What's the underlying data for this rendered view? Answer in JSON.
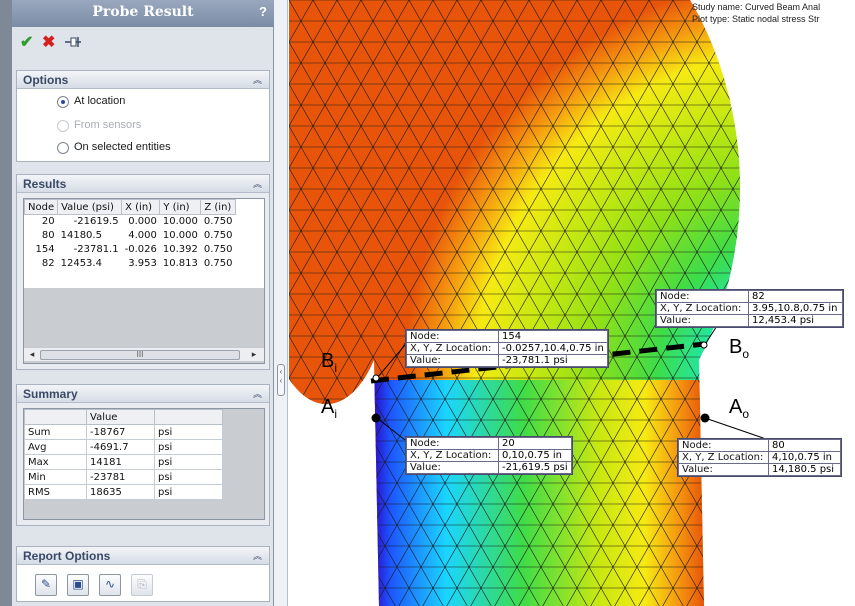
{
  "panel": {
    "title": "Probe Result",
    "help": "?",
    "icons": {
      "ok": "check-icon",
      "cancel": "close-icon",
      "pin": "pushpin-icon"
    }
  },
  "options": {
    "title": "Options",
    "at_location": "At location",
    "from_sensors": "From sensors",
    "on_selected": "On selected entities"
  },
  "results": {
    "title": "Results",
    "columns": [
      "Node",
      "Value (psi)",
      "X (in)",
      "Y (in)",
      "Z (in)"
    ],
    "rows": [
      {
        "node": "20",
        "value": "-21619.5",
        "x": "0.000",
        "y": "10.000",
        "z": "0.750"
      },
      {
        "node": "80",
        "value": "14180.5",
        "x": "4.000",
        "y": "10.000",
        "z": "0.750"
      },
      {
        "node": "154",
        "value": "-23781.1",
        "x": "-0.026",
        "y": "10.392",
        "z": "0.750"
      },
      {
        "node": "82",
        "value": "12453.4",
        "x": "3.953",
        "y": "10.813",
        "z": "0.750"
      }
    ],
    "scroll_thumb": "III"
  },
  "summary": {
    "title": "Summary",
    "column": "Value",
    "rows": [
      {
        "name": "Sum",
        "value": "-18767",
        "unit": "psi"
      },
      {
        "name": "Avg",
        "value": "-4691.7",
        "unit": "psi"
      },
      {
        "name": "Max",
        "value": "14181",
        "unit": "psi"
      },
      {
        "name": "Min",
        "value": "-23781",
        "unit": "psi"
      },
      {
        "name": "RMS",
        "value": "18635",
        "unit": "psi"
      }
    ]
  },
  "report": {
    "title": "Report Options"
  },
  "plot": {
    "study_name": "Study name: Curved Beam Anal",
    "plot_type": "Plot type: Static nodal stress Str"
  },
  "probes": {
    "node_label": "Node:",
    "loc_label": "X, Y, Z Location:",
    "value_label": "Value:",
    "p82": {
      "node": "82",
      "loc": "3.95,10.8,0.75 in",
      "value": "12,453.4  psi"
    },
    "p154": {
      "node": "154",
      "loc": "-0.0257,10.4,0.75 in",
      "value": "-23,781.1 psi"
    },
    "p20": {
      "node": "20",
      "loc": "0,10,0.75 in",
      "value": "-21,619.5 psi"
    },
    "p80": {
      "node": "80",
      "loc": "4,10,0.75 in",
      "value": "14,180.5  psi"
    }
  },
  "points": {
    "bi": {
      "main": "B",
      "sub": "i"
    },
    "bo": {
      "main": "B",
      "sub": "o"
    },
    "ai": {
      "main": "A",
      "sub": "i"
    },
    "ao": {
      "main": "A",
      "sub": "o"
    }
  },
  "colors": {
    "accent": "#2a4aa8",
    "ok": "#2e9d2e",
    "cancel": "#d42020"
  }
}
